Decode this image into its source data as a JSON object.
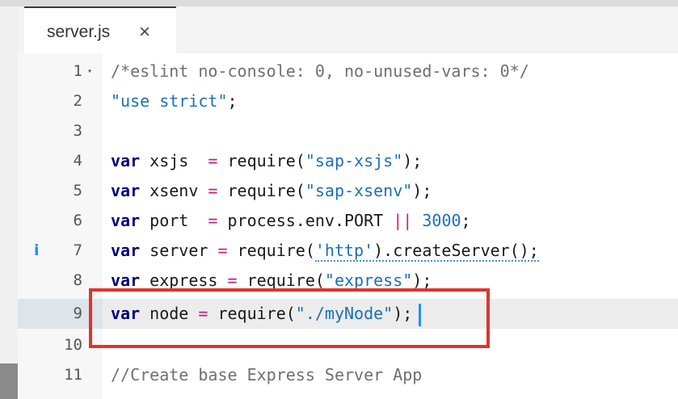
{
  "tab": {
    "label": "server.js",
    "close": "×"
  },
  "lines": [
    {
      "num": "1",
      "text": "/*eslint no-console: 0, no-unused-vars: 0*/"
    },
    {
      "num": "2",
      "text": "\"use strict\";"
    },
    {
      "num": "3",
      "text": ""
    },
    {
      "num": "4",
      "text": "var xsjs  = require(\"sap-xsjs\");"
    },
    {
      "num": "5",
      "text": "var xsenv = require(\"sap-xsenv\");"
    },
    {
      "num": "6",
      "text": "var port  = process.env.PORT || 3000;"
    },
    {
      "num": "7",
      "text": "var server = require('http').createServer();"
    },
    {
      "num": "8",
      "text": "var express = require(\"express\");"
    },
    {
      "num": "9",
      "text": "var node = require(\"./myNode\");"
    },
    {
      "num": "10",
      "text": ""
    },
    {
      "num": "11",
      "text": "//Create base Express Server App"
    }
  ],
  "info_marker": "i",
  "fold_marker": "▾",
  "colors": {
    "highlight_box": "#e0342c",
    "cursor": "#1e90ff",
    "keyword": "#00007f",
    "string": "#1b6fb5",
    "operator": "#c41d7f"
  }
}
